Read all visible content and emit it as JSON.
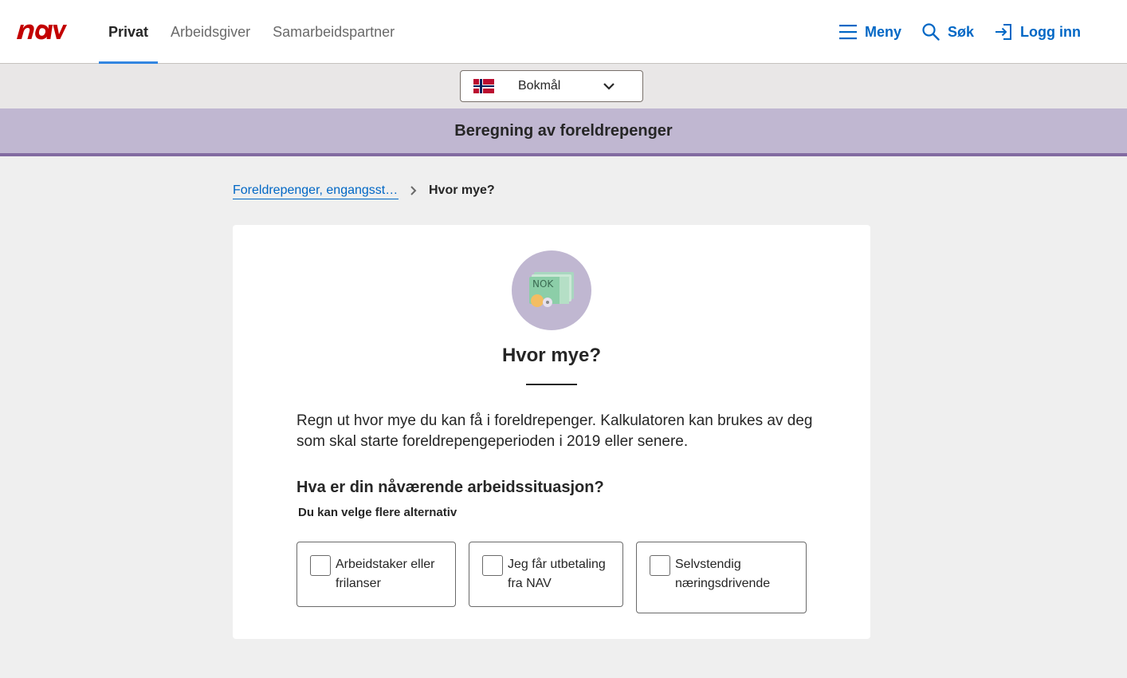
{
  "header": {
    "logo_text": "nav",
    "tabs": [
      {
        "label": "Privat",
        "active": true
      },
      {
        "label": "Arbeidsgiver",
        "active": false
      },
      {
        "label": "Samarbeidspartner",
        "active": false
      }
    ],
    "actions": {
      "menu": {
        "label": "Meny",
        "icon": "hamburger-icon"
      },
      "search": {
        "label": "Søk",
        "icon": "search-icon"
      },
      "login": {
        "label": "Logg inn",
        "icon": "login-icon"
      }
    },
    "accent_color": "#0067c5",
    "active_tab_color": "#3386e0",
    "logo_color": "#c30000"
  },
  "language_selector": {
    "selected": "Bokmål",
    "flag_icon": "norway-flag-icon"
  },
  "banner": {
    "title": "Beregning av foreldrepenger",
    "color": "#c0b7d1"
  },
  "breadcrumb": {
    "link": "Foreldrepenger, engangsstønad og svangerskapspenger",
    "current": "Hvor mye?"
  },
  "card": {
    "illustration_icon": "money-nok-icon",
    "illustration_text": "NOK",
    "title": "Hvor mye?",
    "intro": "Regn ut hvor mye du kan få i foreldrepenger. Kalkulatoren kan brukes av deg som skal starte foreldrepengeperioden i 2019 eller senere.",
    "question": "Hva er din nåværende arbeidssituasjon?",
    "hint": "Du kan velge flere alternativ",
    "options": [
      {
        "label": "Arbeidstaker eller frilanser",
        "checked": false
      },
      {
        "label": "Jeg får utbetaling fra NAV",
        "checked": false
      },
      {
        "label": "Selvstendig næringsdrivende",
        "checked": false
      }
    ]
  }
}
